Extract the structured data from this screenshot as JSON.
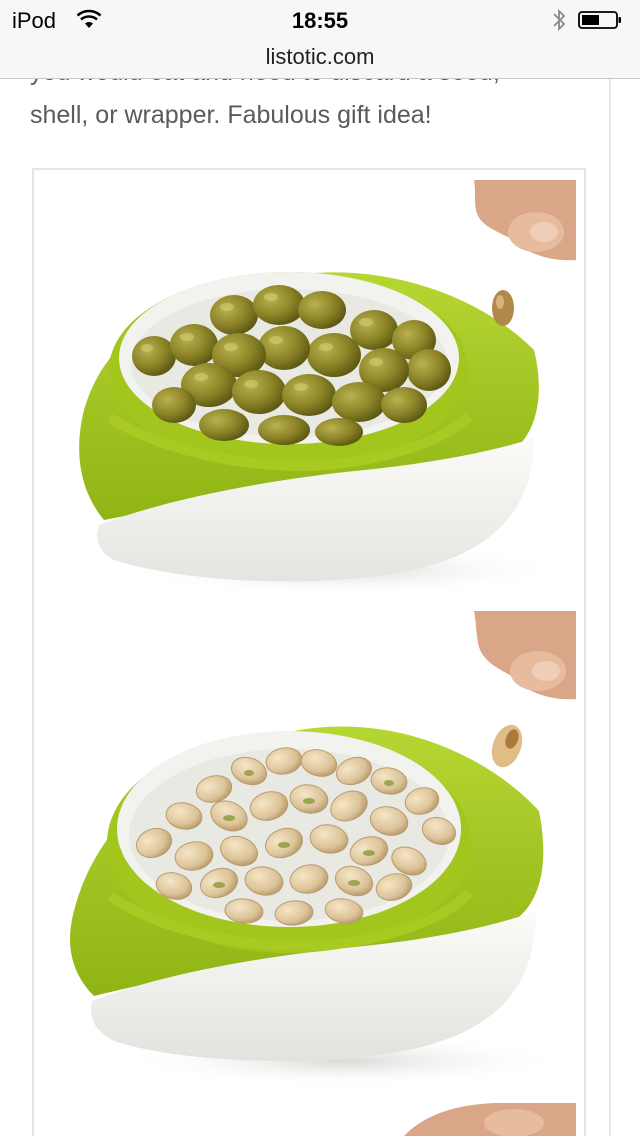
{
  "status_bar": {
    "carrier": "iPod",
    "time": "18:55",
    "icons": [
      "wifi-icon",
      "bluetooth-icon",
      "battery-icon"
    ]
  },
  "browser": {
    "url": "listotic.com"
  },
  "article": {
    "partial_line": "you would eat and need to discard a seed,",
    "text_line": "shell, or wrapper. Fabulous gift idea!"
  },
  "colors": {
    "accent_green": "#9bc41c",
    "text_gray": "#5a5a5a"
  }
}
